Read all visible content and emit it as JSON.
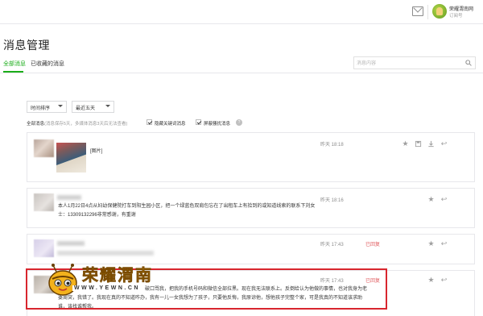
{
  "header": {
    "account_name": "荣耀渭南网",
    "account_type": "订阅号",
    "icons": [
      "mail-icon",
      "avatar"
    ]
  },
  "page": {
    "title": "消息管理",
    "tabs": [
      {
        "label": "全部消息",
        "active": true
      },
      {
        "label": "已收藏的消息",
        "active": false
      }
    ],
    "search": {
      "placeholder": "消息内容",
      "value": ""
    }
  },
  "filters": {
    "sort": "时间排序",
    "range": "最近五天",
    "summary_label": "全部消息",
    "summary_note": "(消息保存5天，多媒体消息3天后无法查看)",
    "hide_keyword": {
      "label": "隐藏关键词消息",
      "checked": true
    },
    "block_harass": {
      "label": "屏蔽骚扰消息",
      "checked": true
    }
  },
  "messages": [
    {
      "text": "[图片]",
      "time": "昨天 18:18",
      "status": "",
      "has_image": true
    },
    {
      "text": "本人1月22日4点从妇幼保健院打车到阳生园小区，把一个绿蓝色双肩包忘在了出租车上有拾到的或知道线索的联系下刘女士：13309132296非常感谢，有重谢",
      "time": "昨天 18:16",
      "status": "",
      "has_image": false
    },
    {
      "text": "",
      "time": "昨天 17:43",
      "status": "已回复",
      "has_image": false
    },
    {
      "text": "…个女人，被我发现了，现在还反过来，破口骂我，把我的手机号码和微信全部拉黑。现在我无法联系上。反倒给认为他做的事情，也对我身为老婆周突，我错了。我现在真的不知道咋办，我有一儿一女我想为了孩子，只要他反悔，我原谅他，想他孩子完整个家，可是我真的不知道该求助谁，该找谁帮我。",
      "time": "昨天 17:43",
      "status": "已回复",
      "has_image": false
    }
  ],
  "watermark": {
    "title": "荣耀渭南",
    "url": "WWW.YEWN.CN"
  },
  "colors": {
    "accent": "#1aad19",
    "status_red": "#e15f63",
    "highlight": "#d8262e"
  }
}
